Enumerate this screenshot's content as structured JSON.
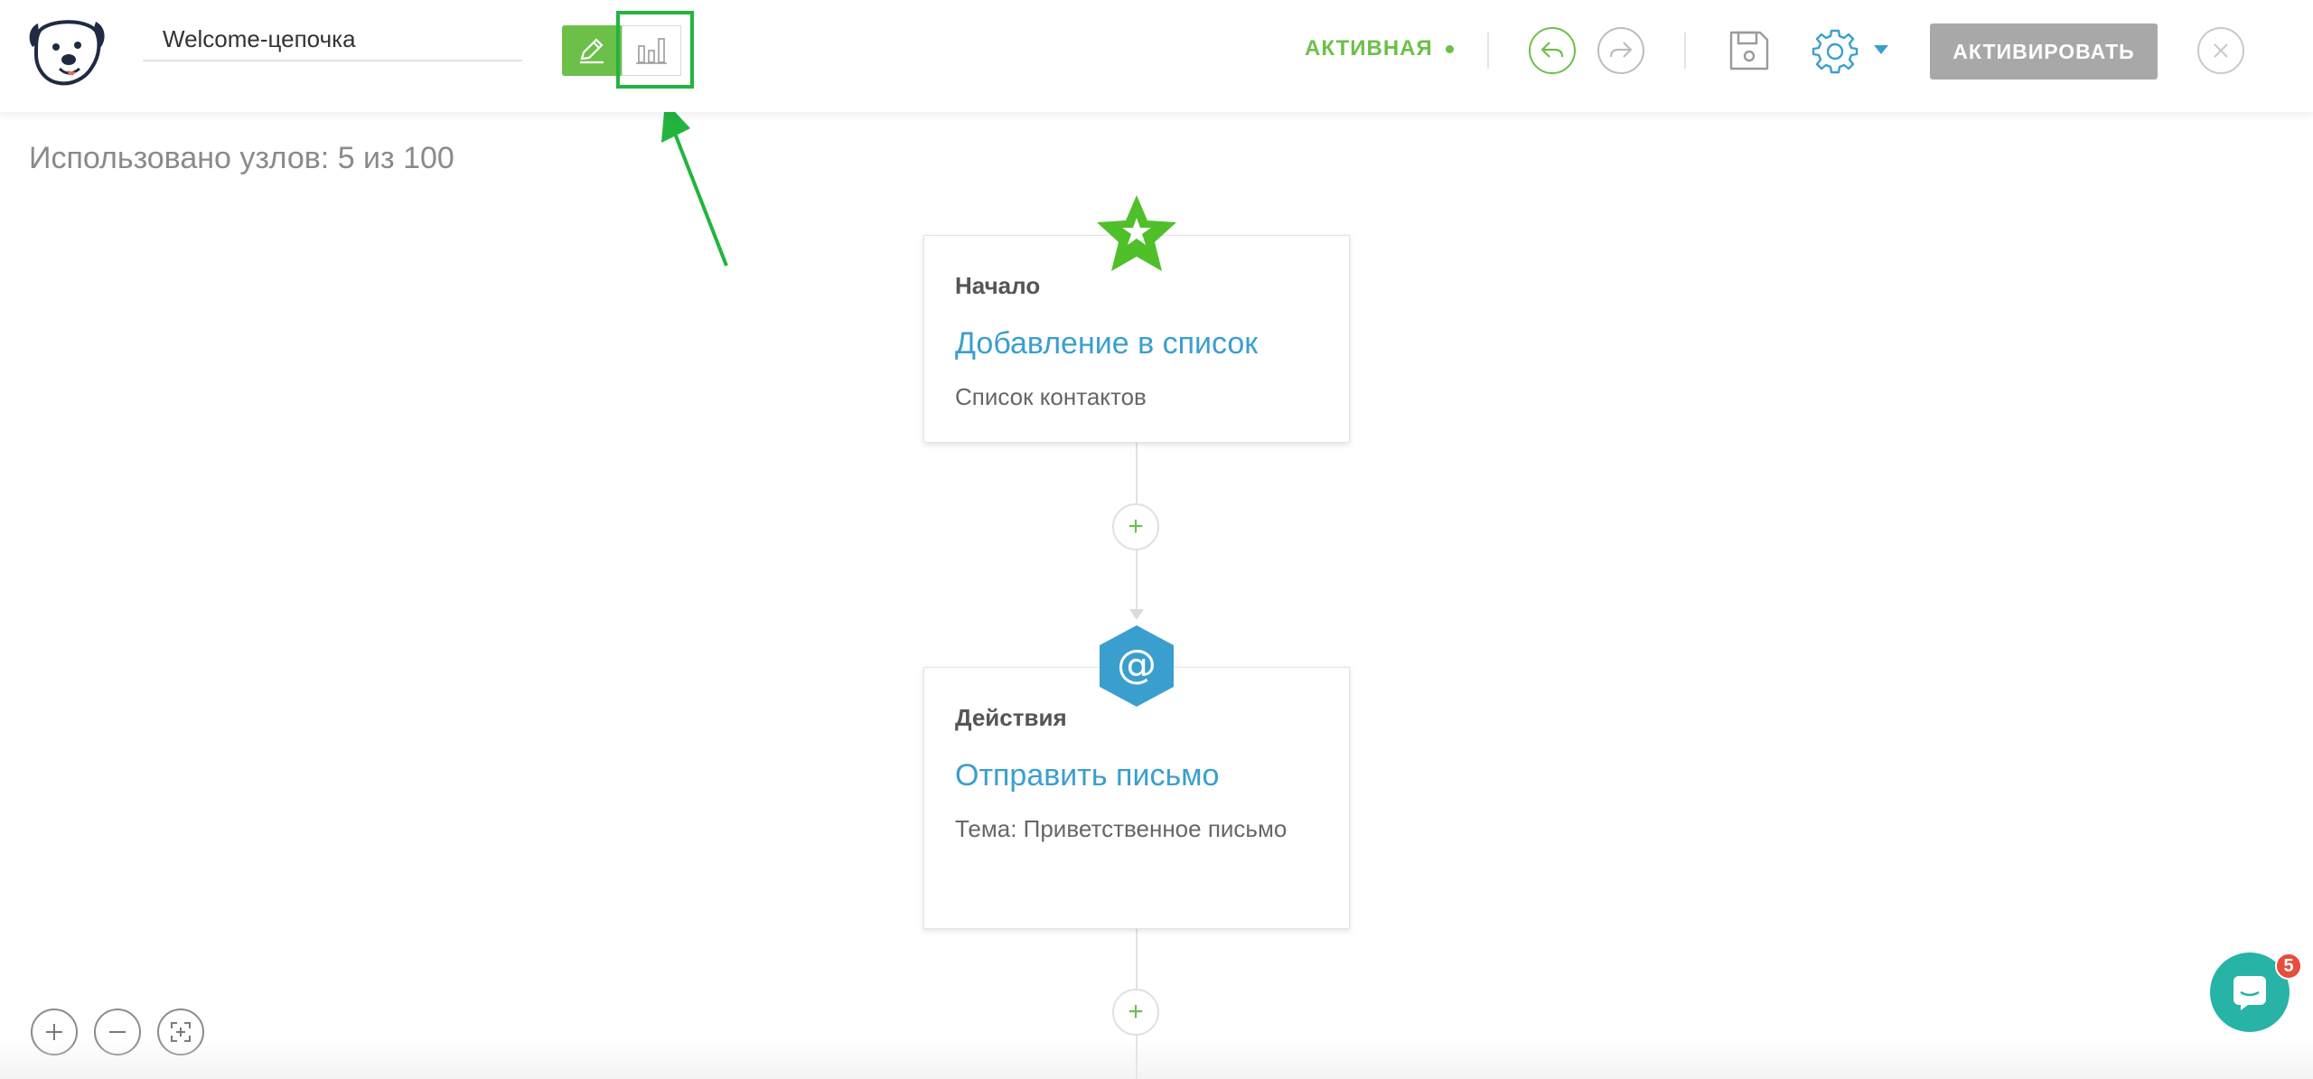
{
  "header": {
    "chain_name": "Welcome-цепочка",
    "status_label": "АКТИВНАЯ",
    "activate_label": "АКТИВИРОВАТЬ"
  },
  "canvas": {
    "nodes_used": "Использовано узлов: 5 из 100"
  },
  "nodes": [
    {
      "category": "Начало",
      "title": "Добавление в список",
      "description": "Список контактов",
      "badge_icon": "star-icon"
    },
    {
      "category": "Действия",
      "title": "Отправить письмо",
      "description": "Тема: Приветственное письмо",
      "badge_icon": "at-sign-icon"
    }
  ],
  "chat": {
    "unread_count": "5"
  },
  "colors": {
    "accent_green": "#6cc04a",
    "link_blue": "#3a9fce",
    "highlight_green": "#22b43f",
    "chat_teal": "#27b3a6",
    "badge_red": "#e84c3d",
    "disabled_button": "#a8a8a8"
  }
}
